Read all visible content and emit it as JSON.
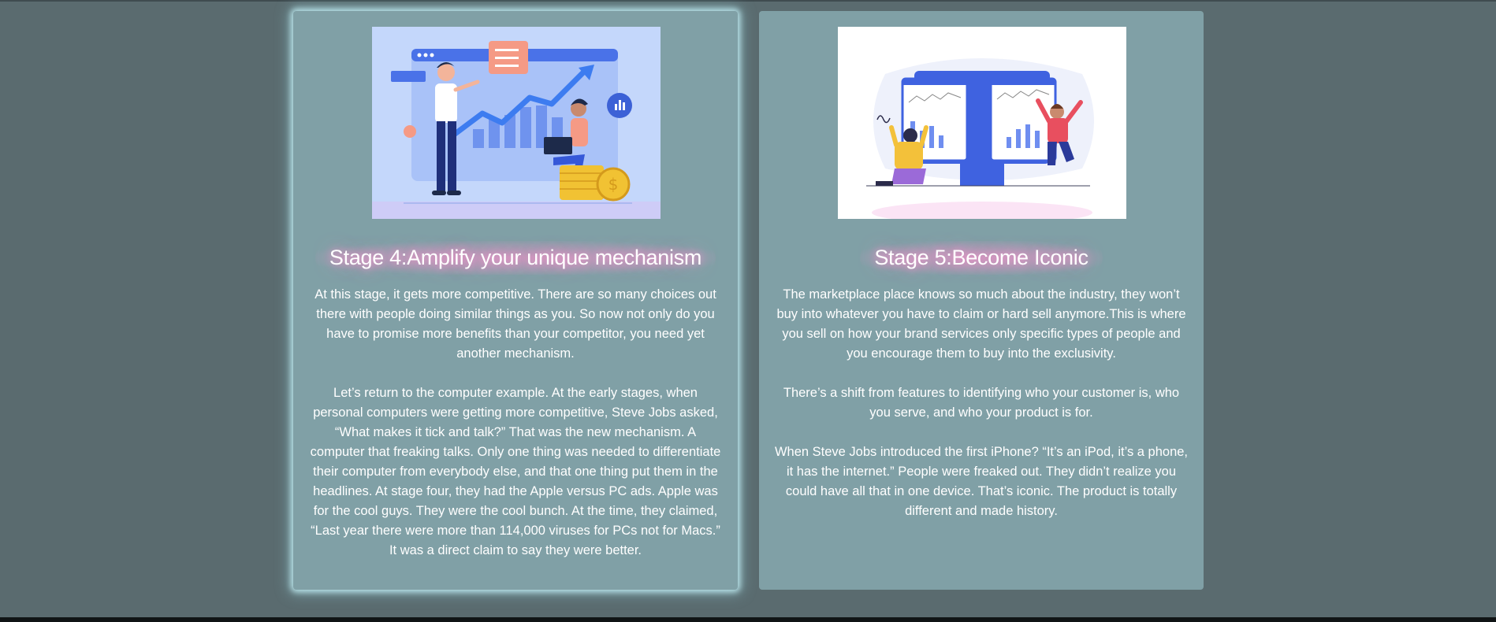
{
  "cards": [
    {
      "title": "Stage 4:Amplify your unique mechanism",
      "image_icon": "business-growth-illustration",
      "paragraphs": [
        "At this stage, it gets more competitive. There are so many choices out there with people doing similar things as you. So now not only do you have to promise more benefits than your competitor, you need yet another mechanism.",
        "Let’s return to the computer example. At the early stages, when personal computers were getting more competitive, Steve Jobs asked, “What makes it tick and talk?” That was the new mechanism. A computer that freaking talks. Only one thing was needed to differentiate their computer from everybody else, and that one thing put them in the headlines. At stage four, they had the Apple versus PC ads. Apple was for the cool guys. They were the cool bunch. At the time, they claimed, “Last year there were more than 114,000 viruses for PCs not for Macs.” It was a direct claim to say they were better."
      ]
    },
    {
      "title": "Stage 5:Become Iconic",
      "image_icon": "celebrating-analytics-illustration",
      "paragraphs": [
        "The marketplace place knows so much about the industry, they won’t buy into whatever you have to claim or hard sell anymore.This is where you sell on how your brand services only specific types of people and you encourage them to buy into the exclusivity.",
        "There’s a shift from features to identifying who your customer is, who you serve, and who your product is for.",
        "When Steve Jobs introduced the first iPhone? “It’s an iPod, it’s a phone, it has the internet.” People were freaked out. They didn’t realize you could have all that in one device. That’s iconic. The product is totally different and made history."
      ]
    }
  ],
  "colors": {
    "page_background": "#5a6b6f",
    "card_background": "#80a0a6",
    "active_glow": "#c8f5fa",
    "title_glow": "#ff96d2"
  }
}
